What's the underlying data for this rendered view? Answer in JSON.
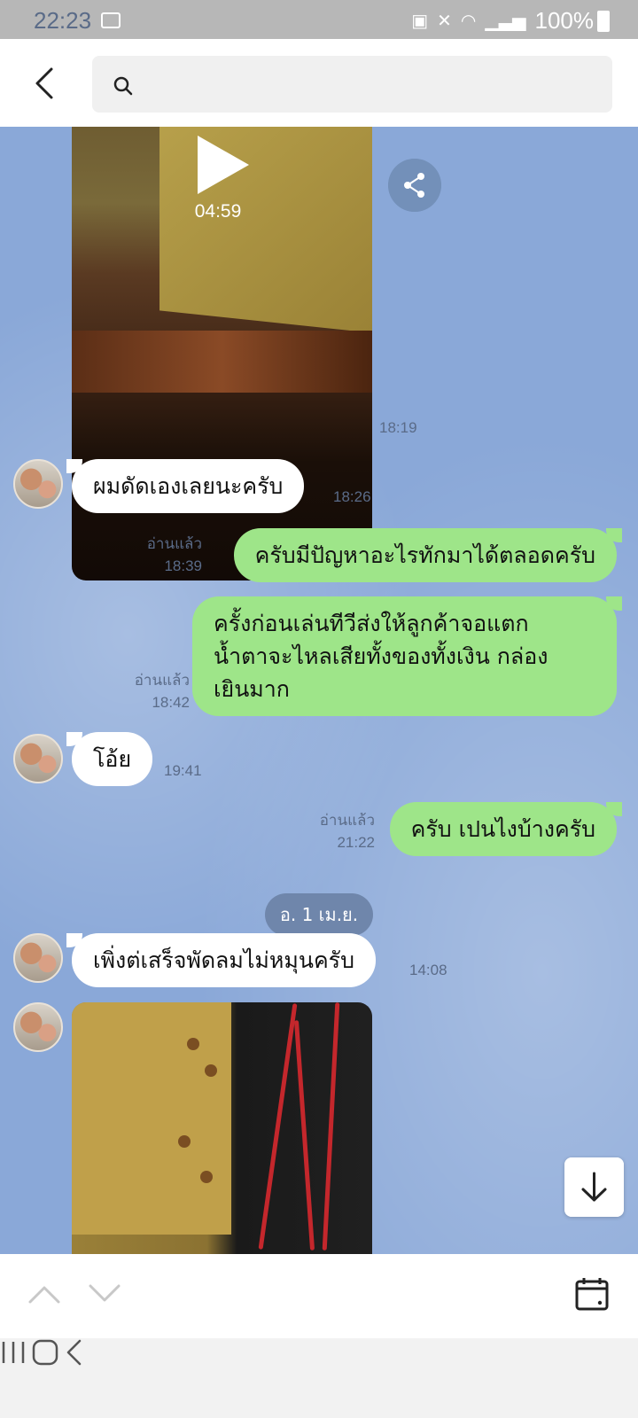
{
  "status_bar": {
    "time": "22:23",
    "battery": "100%"
  },
  "search": {
    "placeholder": ""
  },
  "messages": {
    "video1": {
      "duration": "04:59",
      "time": "18:19"
    },
    "m1": {
      "text": "ผมดัดเองเลยนะครับ",
      "time": "18:26"
    },
    "m2": {
      "text": "ครับมีปัญหาอะไรทักมาได้ตลอดครับ",
      "read": "อ่านแล้ว",
      "time": "18:39"
    },
    "m3": {
      "line1": "ครั้งก่อนเล่นทีวีส่งให้ลูกค้าจอแตก",
      "line2": "น้ำตาจะไหลเสียทั้งของทั้งเงิน กล่อง",
      "line3": "เยินมาก",
      "read": "อ่านแล้ว",
      "time": "18:42"
    },
    "m4": {
      "text": "โอ้ย",
      "time": "19:41"
    },
    "m5": {
      "text": "ครับ เปนไงบ้างครับ",
      "read": "อ่านแล้ว",
      "time": "21:22"
    },
    "date_separator": "อ. 1 เม.ย.",
    "m6": {
      "text": "เพิ่งต่เสร็จพัดลมไม่หมุนครับ",
      "time": "14:08"
    }
  },
  "icons": [
    "back-arrow-icon",
    "search-icon",
    "play-icon",
    "share-icon",
    "scroll-down-arrow-icon",
    "chevron-up-icon",
    "chevron-down-icon",
    "calendar-icon",
    "recents-icon",
    "home-icon",
    "system-back-icon"
  ],
  "colors": {
    "chat_bg": "#8aa8d8",
    "outgoing_bubble": "#9ee589",
    "incoming_bubble": "#ffffff"
  }
}
